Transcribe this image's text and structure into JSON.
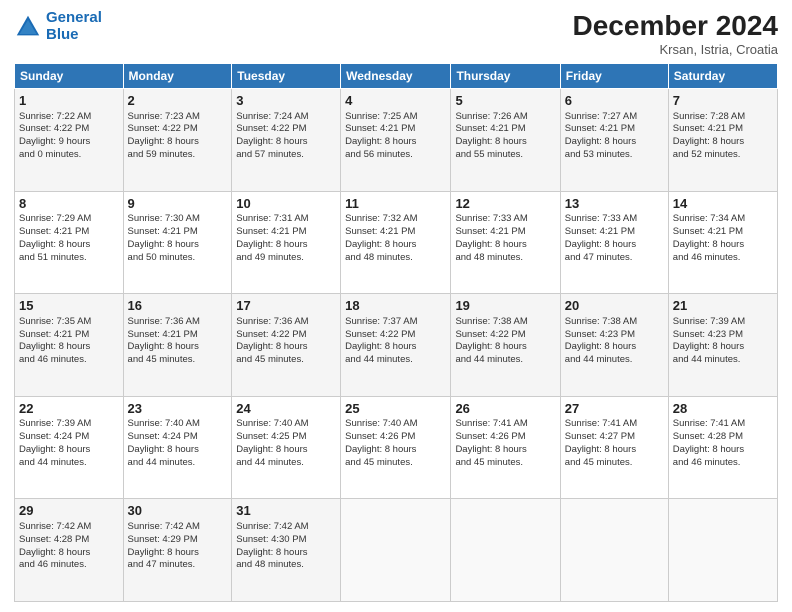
{
  "header": {
    "logo_line1": "General",
    "logo_line2": "Blue",
    "month": "December 2024",
    "location": "Krsan, Istria, Croatia"
  },
  "days_of_week": [
    "Sunday",
    "Monday",
    "Tuesday",
    "Wednesday",
    "Thursday",
    "Friday",
    "Saturday"
  ],
  "weeks": [
    [
      {
        "day": "1",
        "info": "Sunrise: 7:22 AM\nSunset: 4:22 PM\nDaylight: 9 hours\nand 0 minutes."
      },
      {
        "day": "2",
        "info": "Sunrise: 7:23 AM\nSunset: 4:22 PM\nDaylight: 8 hours\nand 59 minutes."
      },
      {
        "day": "3",
        "info": "Sunrise: 7:24 AM\nSunset: 4:22 PM\nDaylight: 8 hours\nand 57 minutes."
      },
      {
        "day": "4",
        "info": "Sunrise: 7:25 AM\nSunset: 4:21 PM\nDaylight: 8 hours\nand 56 minutes."
      },
      {
        "day": "5",
        "info": "Sunrise: 7:26 AM\nSunset: 4:21 PM\nDaylight: 8 hours\nand 55 minutes."
      },
      {
        "day": "6",
        "info": "Sunrise: 7:27 AM\nSunset: 4:21 PM\nDaylight: 8 hours\nand 53 minutes."
      },
      {
        "day": "7",
        "info": "Sunrise: 7:28 AM\nSunset: 4:21 PM\nDaylight: 8 hours\nand 52 minutes."
      }
    ],
    [
      {
        "day": "8",
        "info": "Sunrise: 7:29 AM\nSunset: 4:21 PM\nDaylight: 8 hours\nand 51 minutes."
      },
      {
        "day": "9",
        "info": "Sunrise: 7:30 AM\nSunset: 4:21 PM\nDaylight: 8 hours\nand 50 minutes."
      },
      {
        "day": "10",
        "info": "Sunrise: 7:31 AM\nSunset: 4:21 PM\nDaylight: 8 hours\nand 49 minutes."
      },
      {
        "day": "11",
        "info": "Sunrise: 7:32 AM\nSunset: 4:21 PM\nDaylight: 8 hours\nand 48 minutes."
      },
      {
        "day": "12",
        "info": "Sunrise: 7:33 AM\nSunset: 4:21 PM\nDaylight: 8 hours\nand 48 minutes."
      },
      {
        "day": "13",
        "info": "Sunrise: 7:33 AM\nSunset: 4:21 PM\nDaylight: 8 hours\nand 47 minutes."
      },
      {
        "day": "14",
        "info": "Sunrise: 7:34 AM\nSunset: 4:21 PM\nDaylight: 8 hours\nand 46 minutes."
      }
    ],
    [
      {
        "day": "15",
        "info": "Sunrise: 7:35 AM\nSunset: 4:21 PM\nDaylight: 8 hours\nand 46 minutes."
      },
      {
        "day": "16",
        "info": "Sunrise: 7:36 AM\nSunset: 4:21 PM\nDaylight: 8 hours\nand 45 minutes."
      },
      {
        "day": "17",
        "info": "Sunrise: 7:36 AM\nSunset: 4:22 PM\nDaylight: 8 hours\nand 45 minutes."
      },
      {
        "day": "18",
        "info": "Sunrise: 7:37 AM\nSunset: 4:22 PM\nDaylight: 8 hours\nand 44 minutes."
      },
      {
        "day": "19",
        "info": "Sunrise: 7:38 AM\nSunset: 4:22 PM\nDaylight: 8 hours\nand 44 minutes."
      },
      {
        "day": "20",
        "info": "Sunrise: 7:38 AM\nSunset: 4:23 PM\nDaylight: 8 hours\nand 44 minutes."
      },
      {
        "day": "21",
        "info": "Sunrise: 7:39 AM\nSunset: 4:23 PM\nDaylight: 8 hours\nand 44 minutes."
      }
    ],
    [
      {
        "day": "22",
        "info": "Sunrise: 7:39 AM\nSunset: 4:24 PM\nDaylight: 8 hours\nand 44 minutes."
      },
      {
        "day": "23",
        "info": "Sunrise: 7:40 AM\nSunset: 4:24 PM\nDaylight: 8 hours\nand 44 minutes."
      },
      {
        "day": "24",
        "info": "Sunrise: 7:40 AM\nSunset: 4:25 PM\nDaylight: 8 hours\nand 44 minutes."
      },
      {
        "day": "25",
        "info": "Sunrise: 7:40 AM\nSunset: 4:26 PM\nDaylight: 8 hours\nand 45 minutes."
      },
      {
        "day": "26",
        "info": "Sunrise: 7:41 AM\nSunset: 4:26 PM\nDaylight: 8 hours\nand 45 minutes."
      },
      {
        "day": "27",
        "info": "Sunrise: 7:41 AM\nSunset: 4:27 PM\nDaylight: 8 hours\nand 45 minutes."
      },
      {
        "day": "28",
        "info": "Sunrise: 7:41 AM\nSunset: 4:28 PM\nDaylight: 8 hours\nand 46 minutes."
      }
    ],
    [
      {
        "day": "29",
        "info": "Sunrise: 7:42 AM\nSunset: 4:28 PM\nDaylight: 8 hours\nand 46 minutes."
      },
      {
        "day": "30",
        "info": "Sunrise: 7:42 AM\nSunset: 4:29 PM\nDaylight: 8 hours\nand 47 minutes."
      },
      {
        "day": "31",
        "info": "Sunrise: 7:42 AM\nSunset: 4:30 PM\nDaylight: 8 hours\nand 48 minutes."
      },
      {
        "day": "",
        "info": ""
      },
      {
        "day": "",
        "info": ""
      },
      {
        "day": "",
        "info": ""
      },
      {
        "day": "",
        "info": ""
      }
    ]
  ]
}
